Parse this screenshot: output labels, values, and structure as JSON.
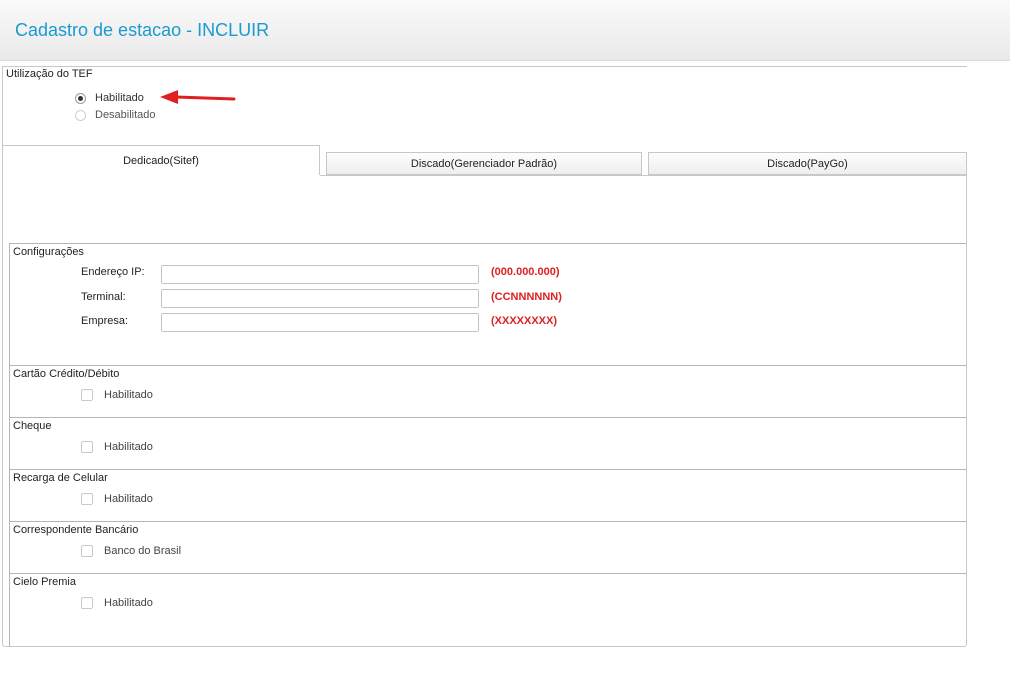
{
  "header": {
    "title": "Cadastro de estacao - INCLUIR"
  },
  "tef": {
    "legend": "Utilização do TEF",
    "options": [
      {
        "label": "Habilitado",
        "selected": true
      },
      {
        "label": "Desabilitado",
        "selected": false
      }
    ]
  },
  "tabs": [
    {
      "label": "Dedicado(Sitef)",
      "active": true
    },
    {
      "label": "Discado(Gerenciador Padrão)",
      "active": false
    },
    {
      "label": "Discado(PayGo)",
      "active": false
    }
  ],
  "config": {
    "title": "Configurações",
    "fields": [
      {
        "label": "Endereço IP:",
        "value": "",
        "hint": "(000.000.000)"
      },
      {
        "label": "Terminal:",
        "value": "",
        "hint": "(CCNNNNNN)"
      },
      {
        "label": "Empresa:",
        "value": "",
        "hint": "(XXXXXXXX)"
      }
    ]
  },
  "groups": [
    {
      "title": "Cartão Crédito/Débito",
      "checkbox_label": "Habilitado",
      "checked": false
    },
    {
      "title": "Cheque",
      "checkbox_label": "Habilitado",
      "checked": false
    },
    {
      "title": "Recarga de Celular",
      "checkbox_label": "Habilitado",
      "checked": false
    },
    {
      "title": "Correspondente Bancário",
      "checkbox_label": "Banco do Brasil",
      "checked": false
    },
    {
      "title": "Cielo Premia",
      "checkbox_label": "Habilitado",
      "checked": false
    }
  ],
  "colors": {
    "title": "#1a9ad0",
    "hint": "#e02020",
    "arrow": "#e02020"
  }
}
